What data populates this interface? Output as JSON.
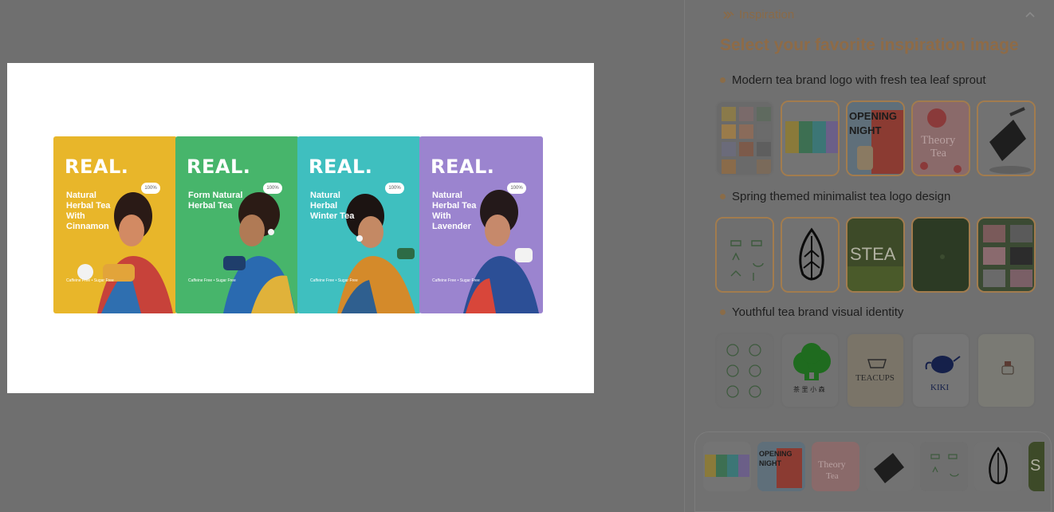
{
  "lightbox": {
    "packages": [
      {
        "brand": "REAL.",
        "name": "Natural Herbal Tea With Cinnamon",
        "badge": "100%",
        "footer": "Caffeine Free • Sugar Free",
        "color": "#e8b62a",
        "face": "#d28a63",
        "hair": "#2a1a16",
        "cloth": "#c7423a"
      },
      {
        "brand": "REAL.",
        "name": "Form Natural Herbal Tea",
        "badge": "100%",
        "footer": "Caffeine Free • Sugar Free",
        "color": "#47b56b",
        "face": "#b07a55",
        "hair": "#2b1b15",
        "cloth": "#2a6ab0"
      },
      {
        "brand": "REAL.",
        "name": "Natural Herbal Winter Tea",
        "badge": "100%",
        "footer": "Caffeine Free • Sugar Free",
        "color": "#3fbfbf",
        "face": "#c48964",
        "hair": "#1c1412",
        "cloth": "#d48a2a"
      },
      {
        "brand": "REAL.",
        "name": "Natural Herbal Tea With Lavender",
        "badge": "100%",
        "footer": "Caffeine Free • Sugar Free",
        "color": "#9b84cf",
        "face": "#c6896b",
        "hair": "#24191a",
        "cloth": "#2c4f96"
      }
    ]
  },
  "panel": {
    "section_title": "Inspiration",
    "heading": "Select your favorite inspiration image",
    "icons": {
      "section": "sparkle-icon",
      "collapse": "chevron-up-icon"
    },
    "colors": {
      "accent": "#8e6b47",
      "dot": "#8a6c48"
    },
    "groups": [
      {
        "label": "Modern tea brand logo with fresh tea leaf sprout",
        "thumbs": [
          "collage",
          "tea-boxes",
          "opening-night",
          "theory-tea",
          "tea-bag"
        ]
      },
      {
        "label": "Spring themed minimalist tea logo design",
        "thumbs": [
          "tea-icons",
          "leaf-emblem",
          "stea",
          "dark-green",
          "tea-grid"
        ]
      },
      {
        "label": "Youthful tea brand visual identity",
        "thumbs": [
          "line-icons",
          "tree-house",
          "teacups",
          "kiki-teapot",
          "tea-cup-logo"
        ]
      }
    ],
    "strip": [
      "tea-boxes",
      "opening-night",
      "theory-tea",
      "tea-bag",
      "tea-icons",
      "leaf-emblem",
      "stea"
    ]
  },
  "thumb_text": {
    "opening": "OPENING",
    "night": "NIGHT",
    "theory": "Theory",
    "tea": "Tea",
    "stea": "STEA",
    "teacups": "TEACUPS",
    "kiki": "KIKI",
    "tree_caption": "茶 里 小 森",
    "s": "S"
  }
}
